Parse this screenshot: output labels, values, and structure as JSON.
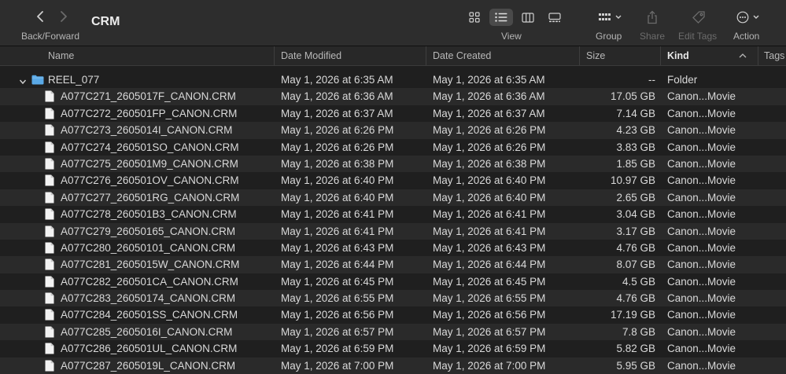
{
  "toolbar": {
    "nav_caption": "Back/Forward",
    "title": "CRM",
    "view_caption": "View",
    "group_caption": "Group",
    "share_caption": "Share",
    "edit_tags_caption": "Edit Tags",
    "action_caption": "Action"
  },
  "columns": {
    "name": "Name",
    "date_modified": "Date Modified",
    "date_created": "Date Created",
    "size": "Size",
    "kind": "Kind",
    "tags": "Tags"
  },
  "folder": {
    "name": "REEL_077",
    "date_modified": "May 1, 2026 at 6:35 AM",
    "date_created": "May 1, 2026 at 6:35 AM",
    "size": "--",
    "kind": "Folder"
  },
  "files": [
    {
      "name": "A077C271_2605017F_CANON.CRM",
      "date_modified": "May 1, 2026 at 6:36 AM",
      "date_created": "May 1, 2026 at 6:36 AM",
      "size": "17.05 GB",
      "kind": "Canon...Movie"
    },
    {
      "name": "A077C272_260501FP_CANON.CRM",
      "date_modified": "May 1, 2026 at 6:37 AM",
      "date_created": "May 1, 2026 at 6:37 AM",
      "size": "7.14 GB",
      "kind": "Canon...Movie"
    },
    {
      "name": "A077C273_2605014I_CANON.CRM",
      "date_modified": "May 1, 2026 at 6:26 PM",
      "date_created": "May 1, 2026 at 6:26 PM",
      "size": "4.23 GB",
      "kind": "Canon...Movie"
    },
    {
      "name": "A077C274_260501SO_CANON.CRM",
      "date_modified": "May 1, 2026 at 6:26 PM",
      "date_created": "May 1, 2026 at 6:26 PM",
      "size": "3.83 GB",
      "kind": "Canon...Movie"
    },
    {
      "name": "A077C275_260501M9_CANON.CRM",
      "date_modified": "May 1, 2026 at 6:38 PM",
      "date_created": "May 1, 2026 at 6:38 PM",
      "size": "1.85 GB",
      "kind": "Canon...Movie"
    },
    {
      "name": "A077C276_260501OV_CANON.CRM",
      "date_modified": "May 1, 2026 at 6:40 PM",
      "date_created": "May 1, 2026 at 6:40 PM",
      "size": "10.97 GB",
      "kind": "Canon...Movie"
    },
    {
      "name": "A077C277_260501RG_CANON.CRM",
      "date_modified": "May 1, 2026 at 6:40 PM",
      "date_created": "May 1, 2026 at 6:40 PM",
      "size": "2.65 GB",
      "kind": "Canon...Movie"
    },
    {
      "name": "A077C278_260501B3_CANON.CRM",
      "date_modified": "May 1, 2026 at 6:41 PM",
      "date_created": "May 1, 2026 at 6:41 PM",
      "size": "3.04 GB",
      "kind": "Canon...Movie"
    },
    {
      "name": "A077C279_26050165_CANON.CRM",
      "date_modified": "May 1, 2026 at 6:41 PM",
      "date_created": "May 1, 2026 at 6:41 PM",
      "size": "3.17 GB",
      "kind": "Canon...Movie"
    },
    {
      "name": "A077C280_26050101_CANON.CRM",
      "date_modified": "May 1, 2026 at 6:43 PM",
      "date_created": "May 1, 2026 at 6:43 PM",
      "size": "4.76 GB",
      "kind": "Canon...Movie"
    },
    {
      "name": "A077C281_2605015W_CANON.CRM",
      "date_modified": "May 1, 2026 at 6:44 PM",
      "date_created": "May 1, 2026 at 6:44 PM",
      "size": "8.07 GB",
      "kind": "Canon...Movie"
    },
    {
      "name": "A077C282_260501CA_CANON.CRM",
      "date_modified": "May 1, 2026 at 6:45 PM",
      "date_created": "May 1, 2026 at 6:45 PM",
      "size": "4.5 GB",
      "kind": "Canon...Movie"
    },
    {
      "name": "A077C283_26050174_CANON.CRM",
      "date_modified": "May 1, 2026 at 6:55 PM",
      "date_created": "May 1, 2026 at 6:55 PM",
      "size": "4.76 GB",
      "kind": "Canon...Movie"
    },
    {
      "name": "A077C284_260501SS_CANON.CRM",
      "date_modified": "May 1, 2026 at 6:56 PM",
      "date_created": "May 1, 2026 at 6:56 PM",
      "size": "17.19 GB",
      "kind": "Canon...Movie"
    },
    {
      "name": "A077C285_2605016I_CANON.CRM",
      "date_modified": "May 1, 2026 at 6:57 PM",
      "date_created": "May 1, 2026 at 6:57 PM",
      "size": "7.8 GB",
      "kind": "Canon...Movie"
    },
    {
      "name": "A077C286_260501UL_CANON.CRM",
      "date_modified": "May 1, 2026 at 6:59 PM",
      "date_created": "May 1, 2026 at 6:59 PM",
      "size": "5.82 GB",
      "kind": "Canon...Movie"
    },
    {
      "name": "A077C287_2605019L_CANON.CRM",
      "date_modified": "May 1, 2026 at 7:00 PM",
      "date_created": "May 1, 2026 at 7:00 PM",
      "size": "5.95 GB",
      "kind": "Canon...Movie"
    }
  ],
  "icons": {
    "back": "chevron-left-icon",
    "forward": "chevron-right-icon",
    "icon_view": "grid-icon",
    "list_view": "list-icon",
    "column_view": "columns-icon",
    "gallery_view": "gallery-icon",
    "group": "group-grid-icon",
    "share": "share-icon",
    "edit_tags": "tag-icon",
    "action": "ellipsis-circle-icon",
    "folder": "folder-icon",
    "file": "document-icon"
  },
  "colors": {
    "folder_blue": "#5aa9e6",
    "accent_active": "#4a4a4a"
  }
}
